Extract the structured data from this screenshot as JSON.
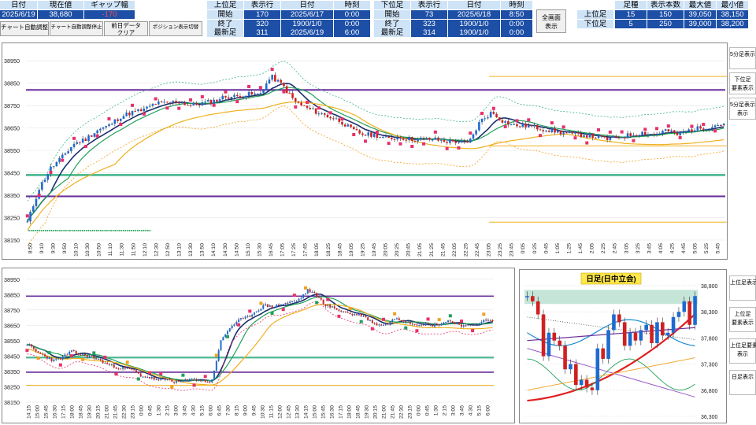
{
  "header": {
    "left": {
      "labels": [
        "日付",
        "現在値",
        "ギャップ幅"
      ],
      "values": [
        "2025/6/19",
        "38,680",
        "-170"
      ]
    },
    "upper_mid": {
      "title_labels": [
        "上位足",
        "表示行",
        "日付",
        "時刻"
      ],
      "rows": [
        {
          "label": "開始",
          "count": "170",
          "date": "2025/6/17",
          "time": "0:00"
        },
        {
          "label": "終了",
          "count": "320",
          "date": "1900/1/0",
          "time": "0:00"
        },
        {
          "label": "最新足",
          "count": "311",
          "date": "2025/6/19",
          "time": "6:00"
        }
      ]
    },
    "lower_mid": {
      "title_labels": [
        "下位足",
        "表示行",
        "日付",
        "時刻"
      ],
      "rows": [
        {
          "label": "開始",
          "count": "73",
          "date": "2025/6/18",
          "time": "8:50"
        },
        {
          "label": "終了",
          "count": "323",
          "date": "1900/1/0",
          "time": "0:00"
        },
        {
          "label": "最新足",
          "count": "314",
          "date": "1900/1/0",
          "time": "0:00"
        }
      ]
    },
    "right": {
      "title_labels": [
        "足種",
        "表示本数",
        "最大値",
        "最小値"
      ],
      "rows": [
        {
          "label": "上位足",
          "kind": "15",
          "count": "150",
          "max": "39,050",
          "min": "38,150"
        },
        {
          "label": "下位足",
          "kind": "5",
          "count": "250",
          "max": "39,000",
          "min": "38,200"
        }
      ]
    },
    "buttons": {
      "auto_adjust": "チャート自動調整",
      "auto_stop": "チャート自動調整停止",
      "prev_clear_1": "前日データ",
      "prev_clear_2": "クリア",
      "position": "ポジション表示切替",
      "full_1": "全画面",
      "full_2": "表示"
    }
  },
  "side_buttons": {
    "top": [
      "5分足表示",
      "下位足\n要素表示",
      "5分足表示\n表示"
    ],
    "bottom": [
      "上位足表示",
      "上位足\n要素表示",
      "上位足要素\n表示",
      "日足表示"
    ]
  },
  "colors": {
    "header_label_bg": "#cfe3f7",
    "header_value_bg": "#1d4fa6",
    "negative": "#e02020",
    "ma_navy": "#1a2f6e",
    "ma_green": "#22a05a",
    "ma_orange": "#f0b020",
    "band_purple": "#6a2d9c",
    "band_teal": "#3fb58a",
    "bull": "#1e6ad0",
    "bear": "#d02020"
  },
  "chart_data": [
    {
      "type": "candlestick",
      "name": "upper",
      "yticks": [
        "38950",
        "38850",
        "38750",
        "38650",
        "38550",
        "38450",
        "38350",
        "38250",
        "38150"
      ],
      "ylim": [
        38150,
        39000
      ],
      "xticks": [
        "8:50",
        "9:10",
        "9:30",
        "9:50",
        "10:10",
        "10:30",
        "10:50",
        "11:10",
        "11:30",
        "11:50",
        "12:10",
        "12:30",
        "12:50",
        "13:10",
        "13:30",
        "13:50",
        "14:10",
        "14:30",
        "14:50",
        "15:10",
        "15:30",
        "16:45",
        "17:05",
        "17:25",
        "17:45",
        "18:05",
        "18:25",
        "18:45",
        "19:05",
        "19:25",
        "19:45",
        "20:05",
        "20:25",
        "20:45",
        "21:05",
        "21:25",
        "21:45",
        "22:05",
        "22:25",
        "22:45",
        "23:05",
        "23:25",
        "23:45",
        "0:05",
        "0:25",
        "0:45",
        "1:05",
        "1:25",
        "1:45",
        "2:05",
        "2:25",
        "2:45",
        "3:05",
        "3:25",
        "3:45",
        "4:05",
        "4:25",
        "4:45",
        "5:05",
        "5:25",
        "5:45"
      ],
      "close": [
        38230,
        38380,
        38470,
        38520,
        38580,
        38600,
        38640,
        38660,
        38700,
        38720,
        38730,
        38760,
        38760,
        38770,
        38750,
        38760,
        38770,
        38790,
        38790,
        38800,
        38800,
        38880,
        38840,
        38770,
        38740,
        38720,
        38700,
        38680,
        38640,
        38620,
        38620,
        38600,
        38610,
        38600,
        38600,
        38600,
        38590,
        38590,
        38580,
        38680,
        38720,
        38680,
        38660,
        38660,
        38650,
        38640,
        38630,
        38620,
        38620,
        38610,
        38600,
        38610,
        38620,
        38630,
        38620,
        38640,
        38620,
        38640,
        38650,
        38660,
        38670
      ]
    },
    {
      "type": "candlestick",
      "name": "lower",
      "yticks": [
        "38950",
        "38850",
        "38750",
        "38650",
        "38550",
        "38450",
        "38350",
        "38250",
        "38150"
      ],
      "ylim": [
        38150,
        39000
      ],
      "xticks": [
        "14:15",
        "15:00",
        "15:45",
        "16:30",
        "17:15",
        "18:00",
        "18:45",
        "19:30",
        "20:15",
        "21:00",
        "21:45",
        "22:30",
        "23:15",
        "0:00",
        "0:45",
        "1:30",
        "2:15",
        "3:00",
        "3:45",
        "4:30",
        "5:15",
        "6:00",
        "6:45",
        "7:30",
        "8:15",
        "9:00",
        "9:45",
        "10:30",
        "11:15",
        "12:00",
        "12:45",
        "13:30",
        "14:15",
        "15:00",
        "15:45",
        "16:30",
        "17:15",
        "18:00",
        "18:45",
        "19:30",
        "20:15",
        "21:00",
        "21:45",
        "22:30",
        "23:15",
        "0:00",
        "0:45",
        "1:30",
        "2:15",
        "3:00",
        "3:45",
        "4:30",
        "5:15",
        "6:00"
      ],
      "close": [
        38530,
        38480,
        38450,
        38420,
        38440,
        38480,
        38460,
        38450,
        38430,
        38400,
        38380,
        38370,
        38360,
        38320,
        38310,
        38290,
        38300,
        38280,
        38290,
        38300,
        38290,
        38280,
        38540,
        38630,
        38680,
        38700,
        38740,
        38780,
        38770,
        38790,
        38800,
        38820,
        38880,
        38840,
        38780,
        38760,
        38740,
        38720,
        38720,
        38680,
        38650,
        38660,
        38700,
        38680,
        38660,
        38660,
        38650,
        38660,
        38680,
        38660,
        38640,
        38660,
        38680,
        38680
      ]
    },
    {
      "type": "candlestick",
      "name": "daily",
      "title": "日足(日中立会)",
      "yticks": [
        "38,800",
        "38,300",
        "37,800",
        "37,300",
        "36,800",
        "36,300"
      ],
      "ylim": [
        36300,
        38950
      ],
      "close": [
        38600,
        38500,
        38250,
        37450,
        37900,
        37750,
        37650,
        37200,
        37300,
        36900,
        37000,
        36850,
        36800,
        37600,
        37400,
        37950,
        38250,
        38100,
        37650,
        37900,
        37750,
        37950,
        38050,
        37700,
        38100,
        37850,
        37900,
        38200,
        38300,
        38500,
        38050,
        38600
      ]
    }
  ]
}
